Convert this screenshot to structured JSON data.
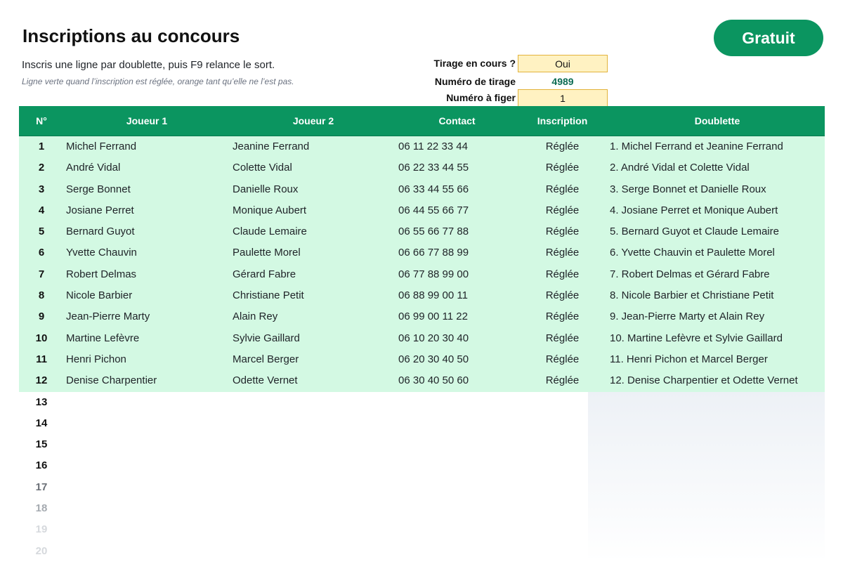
{
  "page": {
    "title": "Inscriptions au concours",
    "badge": "Gratuit",
    "instruction": "Inscris une ligne par doublette, puis F9 relance le sort.",
    "hint": "Ligne verte quand l’inscription est réglée, orange tant qu’elle ne l’est pas."
  },
  "controls": {
    "tirage_label": "Tirage en cours ?",
    "tirage_value": "Oui",
    "numero_label": "Numéro de tirage",
    "numero_value": "4989",
    "figer_label": "Numéro à figer",
    "figer_value": "1"
  },
  "table": {
    "headers": {
      "num": "N°",
      "joueur1": "Joueur 1",
      "joueur2": "Joueur 2",
      "contact": "Contact",
      "inscription": "Inscription",
      "doublette": "Doublette"
    },
    "rows": [
      {
        "num": "1",
        "joueur1": "Michel Ferrand",
        "joueur2": "Jeanine Ferrand",
        "contact": "06 11 22 33 44",
        "inscription": "Réglée",
        "doublette": "1. Michel Ferrand et Jeanine Ferrand"
      },
      {
        "num": "2",
        "joueur1": "André Vidal",
        "joueur2": "Colette Vidal",
        "contact": "06 22 33 44 55",
        "inscription": "Réglée",
        "doublette": "2. André Vidal et Colette Vidal"
      },
      {
        "num": "3",
        "joueur1": "Serge Bonnet",
        "joueur2": "Danielle Roux",
        "contact": "06 33 44 55 66",
        "inscription": "Réglée",
        "doublette": "3. Serge Bonnet et Danielle Roux"
      },
      {
        "num": "4",
        "joueur1": "Josiane Perret",
        "joueur2": "Monique Aubert",
        "contact": "06 44 55 66 77",
        "inscription": "Réglée",
        "doublette": "4. Josiane Perret et Monique Aubert"
      },
      {
        "num": "5",
        "joueur1": "Bernard Guyot",
        "joueur2": "Claude Lemaire",
        "contact": "06 55 66 77 88",
        "inscription": "Réglée",
        "doublette": "5. Bernard Guyot et Claude Lemaire"
      },
      {
        "num": "6",
        "joueur1": "Yvette Chauvin",
        "joueur2": "Paulette Morel",
        "contact": "06 66 77 88 99",
        "inscription": "Réglée",
        "doublette": "6. Yvette Chauvin et Paulette Morel"
      },
      {
        "num": "7",
        "joueur1": "Robert Delmas",
        "joueur2": "Gérard Fabre",
        "contact": "06 77 88 99 00",
        "inscription": "Réglée",
        "doublette": "7. Robert Delmas et Gérard Fabre"
      },
      {
        "num": "8",
        "joueur1": "Nicole Barbier",
        "joueur2": "Christiane Petit",
        "contact": "06 88 99 00 11",
        "inscription": "Réglée",
        "doublette": "8. Nicole Barbier et Christiane Petit"
      },
      {
        "num": "9",
        "joueur1": "Jean-Pierre Marty",
        "joueur2": "Alain Rey",
        "contact": "06 99 00 11 22",
        "inscription": "Réglée",
        "doublette": "9. Jean-Pierre Marty et Alain Rey"
      },
      {
        "num": "10",
        "joueur1": "Martine Lefèvre",
        "joueur2": "Sylvie Gaillard",
        "contact": "06 10 20 30 40",
        "inscription": "Réglée",
        "doublette": "10. Martine Lefèvre et Sylvie Gaillard"
      },
      {
        "num": "11",
        "joueur1": "Henri Pichon",
        "joueur2": "Marcel Berger",
        "contact": "06 20 30 40 50",
        "inscription": "Réglée",
        "doublette": "11. Henri Pichon et Marcel Berger"
      },
      {
        "num": "12",
        "joueur1": "Denise Charpentier",
        "joueur2": "Odette Vernet",
        "contact": "06 30 40 50 60",
        "inscription": "Réglée",
        "doublette": "12. Denise Charpentier et Odette Vernet"
      }
    ],
    "empty_rows": [
      "13",
      "14",
      "15",
      "16",
      "17",
      "18",
      "19",
      "20"
    ]
  },
  "colors": {
    "accent": "#0b9560",
    "row_paid": "#d3f9e3",
    "input_fill": "#fff2c2",
    "input_border": "#e2b33c"
  }
}
